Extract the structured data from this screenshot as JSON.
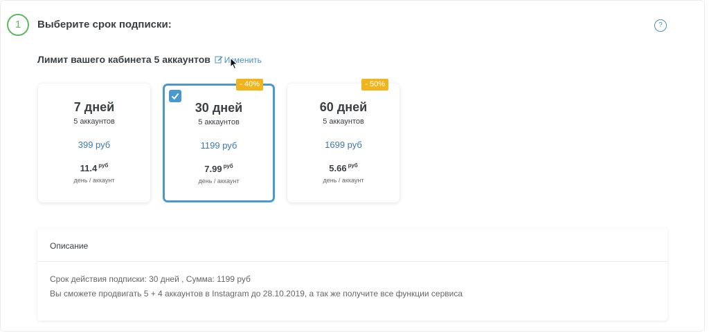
{
  "step": {
    "number": "1",
    "title": "Выберите срок подписки:",
    "help_icon": "question-mark-icon",
    "help_glyph": "?"
  },
  "limit": {
    "text": "Лимит вашего кабинета 5 аккаунтов",
    "edit_label": "Изменить",
    "edit_icon": "edit-icon"
  },
  "plans": [
    {
      "days": "7 дней",
      "accounts": "5 аккаунтов",
      "price": "399 руб",
      "per_value": "11.4",
      "per_unit": "руб",
      "per_label": "день / аккаунт",
      "badge": "",
      "selected": false
    },
    {
      "days": "30 дней",
      "accounts": "5 аккаунтов",
      "price": "1199 руб",
      "per_value": "7.99",
      "per_unit": "руб",
      "per_label": "день / аккаунт",
      "badge": "- 40%",
      "selected": true
    },
    {
      "days": "60 дней",
      "accounts": "5 аккаунтов",
      "price": "1699 руб",
      "per_value": "5.66",
      "per_unit": "руб",
      "per_label": "день / аккаунт",
      "badge": "- 50%",
      "selected": false
    }
  ],
  "description": {
    "header": "Описание",
    "line1": "Срок действия подписки: 30 дней , Сумма: 1199 руб",
    "line2": "Вы сможете продвигать 5 + 4 аккаунтов в Instagram до 28.10.2019, а так же получите все функции сервиса"
  },
  "colors": {
    "accent_green": "#5cb85c",
    "accent_blue": "#4a98d0",
    "link_blue": "#3b78ad",
    "badge_yellow": "#f0b51c"
  }
}
